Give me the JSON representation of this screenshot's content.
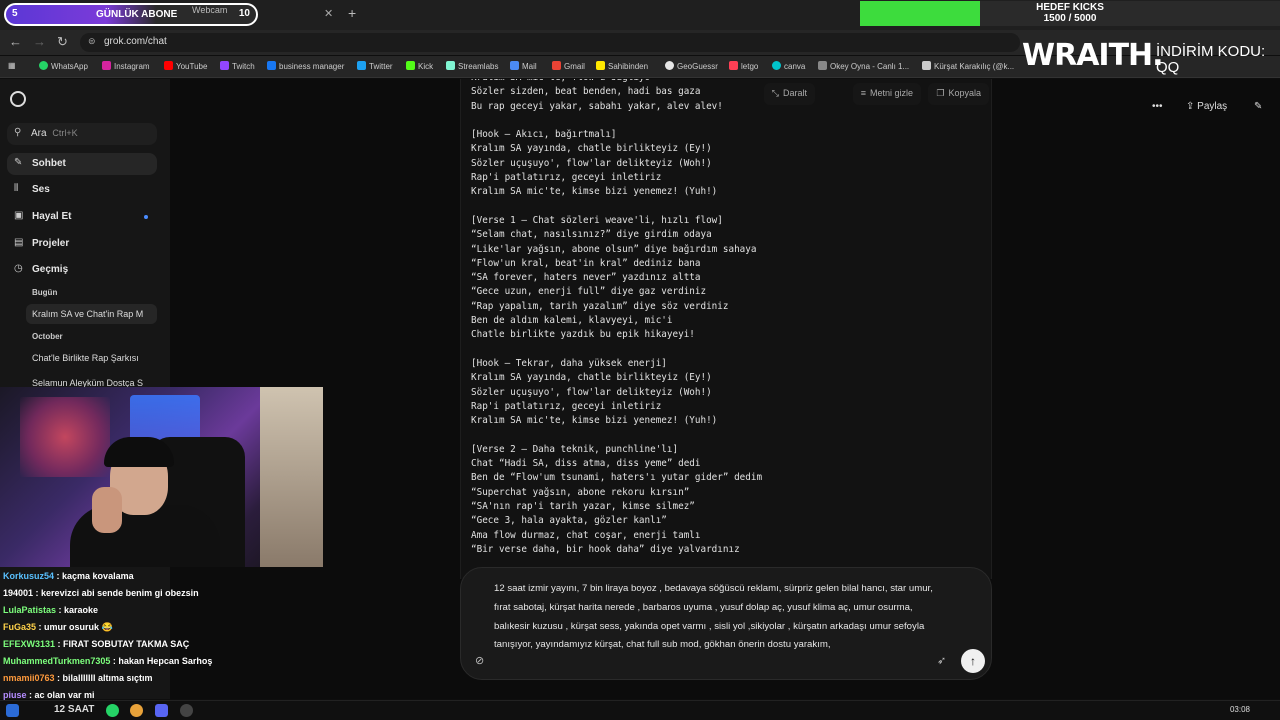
{
  "browser": {
    "goal_pill": {
      "left_num": "5",
      "label": "GÜNLÜK ABONE",
      "count": "10"
    },
    "tabs": [
      {
        "label": "Webcam"
      }
    ],
    "kicks": {
      "title": "HEDEF KICKS",
      "progress": "1500 / 5000",
      "fill_fraction": 0.3,
      "fill_color": "#3ddc3d"
    },
    "url": "grok.com/chat",
    "bookmarks": [
      {
        "label": "WhatsApp",
        "color": "#25d366"
      },
      {
        "label": "Instagram",
        "color": "#d6249f"
      },
      {
        "label": "YouTube",
        "color": "#ff0000"
      },
      {
        "label": "Twitch",
        "color": "#9146ff"
      },
      {
        "label": "business manager",
        "color": "#1877f2"
      },
      {
        "label": "Twitter",
        "color": "#1da1f2"
      },
      {
        "label": "Kick",
        "color": "#53fc18"
      },
      {
        "label": "Streamlabs",
        "color": "#80f5d2"
      },
      {
        "label": "Mail",
        "color": "#4b8bf5"
      },
      {
        "label": "Gmail",
        "color": "#ea4335"
      },
      {
        "label": "Sahibinden",
        "color": "#ffe800"
      },
      {
        "label": "GeoGuessr",
        "color": "#e5e5e5"
      },
      {
        "label": "letgo",
        "color": "#ff3f55"
      },
      {
        "label": "canva",
        "color": "#00c4cc"
      },
      {
        "label": "Okey Oyna - Canlı 1...",
        "color": "#888888"
      },
      {
        "label": "Kürşat Karakılıç (@k...",
        "color": "#cccccc"
      }
    ],
    "overlay": {
      "brand": "WRAITH.",
      "promo_line1": "İNDİRİM KODU:",
      "promo_line2": "QQ"
    }
  },
  "sidebar": {
    "search_label": "Ara",
    "search_shortcut": "Ctrl+K",
    "nav": [
      {
        "label": "Sohbet",
        "icon": "chat-icon"
      },
      {
        "label": "Ses",
        "icon": "voice-icon"
      },
      {
        "label": "Hayal Et",
        "icon": "image-icon"
      },
      {
        "label": "Projeler",
        "icon": "folder-icon"
      },
      {
        "label": "Geçmiş",
        "icon": "history-icon"
      }
    ],
    "history_today_label": "Bugün",
    "history_today": [
      "Kralım SA ve Chat'in Rap M"
    ],
    "history_october_label": "October",
    "history_october": [
      "Chat'le Birlikte Rap Şarkısı",
      "Selamun Aleyküm Dostça S"
    ]
  },
  "main": {
    "code_actions": [
      {
        "label": "Daralt",
        "icon": "collapse-icon"
      },
      {
        "label": "Metni gizle",
        "icon": "hide-text-icon"
      },
      {
        "label": "Kopyala",
        "icon": "copy-icon"
      }
    ],
    "share_label": "Paylaş",
    "lyrics": [
      "Kralım SA mic'te, flow'u sağlıyo",
      "Sözler sizden, beat benden, hadi bas gaza",
      "Bu rap geceyi yakar, sabahı yakar, alev alev!",
      "",
      "[Hook – Akıcı, bağırtmalı]",
      "Kralım SA yayında, chatle birlikteyiz (Ey!)",
      "Sözler uçuşuyo', flow'lar delikteyiz (Woh!)",
      "Rap'i patlatırız, geceyi inletiriz",
      "Kralım SA mic'te, kimse bizi yenemez! (Yuh!)",
      "",
      "[Verse 1 – Chat sözleri weave'li, hızlı flow]",
      "“Selam chat, nasılsınız?” diye girdim odaya",
      "“Like'lar yağsın, abone olsun” diye bağırdım sahaya",
      "“Flow'un kral, beat'in kral” dediniz bana",
      "“SA forever, haters never” yazdınız altta",
      "“Gece uzun, enerji full” diye gaz verdiniz",
      "“Rap yapalım, tarih yazalım” diye söz verdiniz",
      "Ben de aldım kalemi, klavyeyi, mic'i",
      "Chatle birlikte yazdık bu epik hikayeyi!",
      "",
      "[Hook – Tekrar, daha yüksek enerji]",
      "Kralım SA yayında, chatle birlikteyiz (Ey!)",
      "Sözler uçuşuyo', flow'lar delikteyiz (Woh!)",
      "Rap'i patlatırız, geceyi inletiriz",
      "Kralım SA mic'te, kimse bizi yenemez! (Yuh!)",
      "",
      "[Verse 2 – Daha teknik, punchline'lı]",
      "Chat “Hadi SA, diss atma, diss yeme” dedi",
      "Ben de “Flow'um tsunami, haters'ı yutar gider” dedim",
      "“Superchat yağsın, abone rekoru kırsın”",
      "“SA'nın rap'i tarih yazar, kimse silmez”",
      "“Gece 3, hala ayakta, gözler kanlı”",
      "Ama flow durmaz, chat coşar, enerji tamlı",
      "“Bir verse daha, bir hook daha” diye yalvardınız"
    ],
    "composer_text": "12 saat izmir yayını, 7 bin liraya boyoz , bedavaya söğüscü reklamı, sürpriz gelen bilal hancı, star umur, fırat sabotaj, kürşat harita nerede , barbaros uyuma , yusuf dolap aç, yusuf klima aç, umur osurma, balıkesir kuzusu , kürşat sess, yakında opet varmı , sisli yol ,sikiyolar , kürşatın arkadaşı umur sefoyla tanışıyor, yayındamıyız kürşat, chat full sub mod, gökhan önerin dostu yarakım,"
  },
  "stream_chat": [
    {
      "user": "Korkusuz54",
      "msg": "kaçma kovalama",
      "color": "#59c1ff"
    },
    {
      "user": "194001",
      "msg": "kerevizci abi sende benim gi obezsin",
      "color": "#ffffff"
    },
    {
      "user": "LulaPatistas",
      "msg": "karaoke",
      "color": "#7dff7d"
    },
    {
      "user": "FuGa35",
      "msg": "umur osuruk 😂",
      "color": "#ffd24a"
    },
    {
      "user": "EFEXW3131",
      "msg": "FIRAT SOBUTAY TAKMA SAÇ",
      "color": "#7dff7d"
    },
    {
      "user": "MuhammedTurkmen7305",
      "msg": "hakan Hepcan Sarhoş",
      "color": "#7dff7d"
    },
    {
      "user": "nmamii0763",
      "msg": "bilalllllll altıma sıçtım",
      "color": "#ff9a3c"
    },
    {
      "user": "piuse",
      "msg": "ac olan var mi",
      "color": "#b48cff"
    }
  ],
  "taskbar": {
    "live_label": "12 SAAT",
    "time": "03:08"
  }
}
